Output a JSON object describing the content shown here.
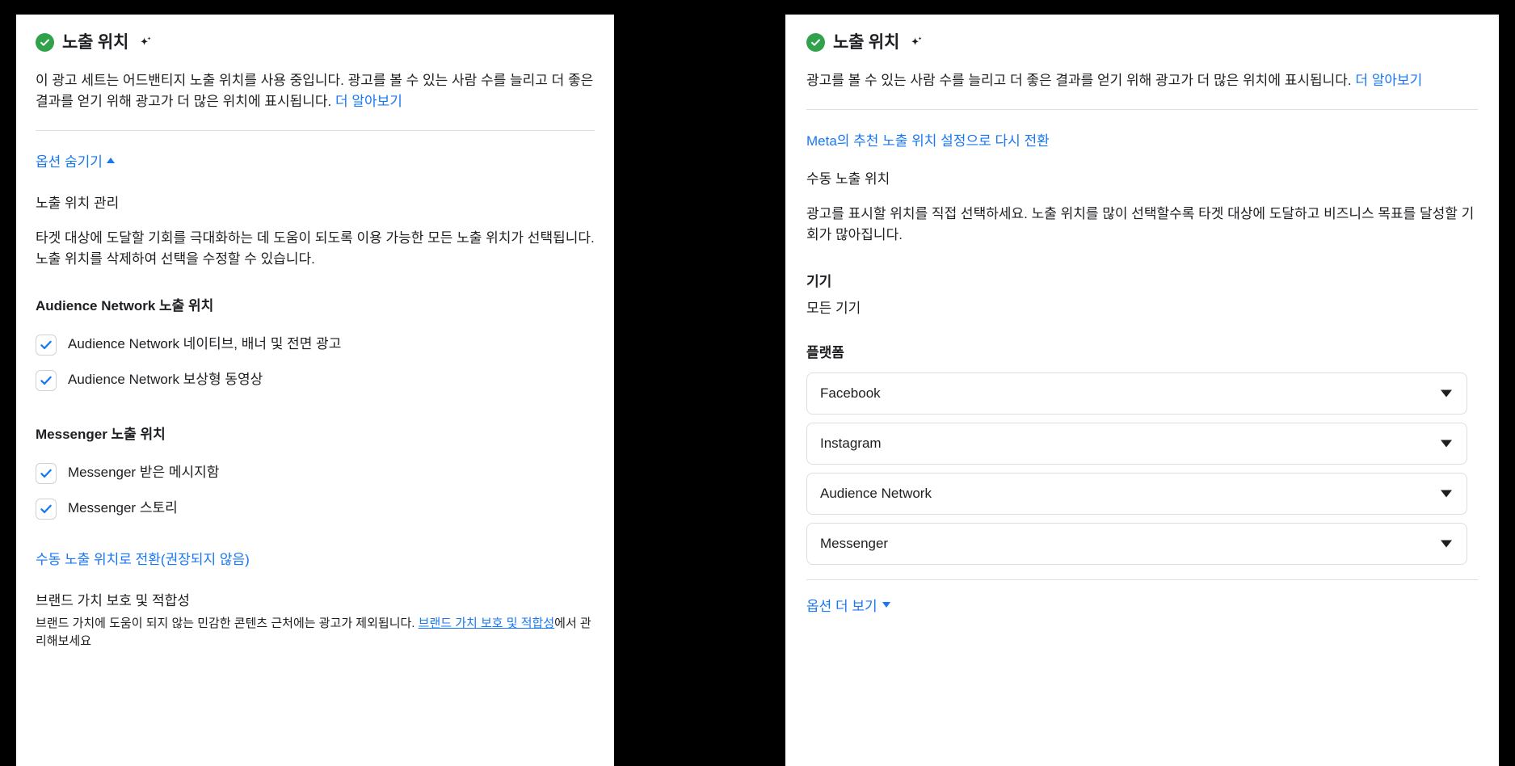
{
  "left_panel": {
    "header": {
      "status_icon": "green-check-circle-icon",
      "title": "노출 위치",
      "ai_icon": "sparkle-icon"
    },
    "intro": {
      "text": "이 광고 세트는 어드밴티지 노출 위치를 사용 중입니다. 광고를 볼 수 있는 사람 수를 늘리고 더 좋은 결과를 얻기 위해 광고가 더 많은 위치에 표시됩니다. ",
      "link": "더 알아보기"
    },
    "toggle_options": {
      "label": "옵션 숨기기",
      "caret": "caret-up-icon"
    },
    "manage_heading": "노출 위치 관리",
    "manage_body": "타겟 대상에 도달할 기회를 극대화하는 데 도움이 되도록 이용 가능한 모든 노출 위치가 선택됩니다. 노출 위치를 삭제하여 선택을 수정할 수 있습니다.",
    "groups": [
      {
        "heading": "Audience Network 노출 위치",
        "items": [
          {
            "label": "Audience Network 네이티브, 배너 및 전면 광고",
            "checked": true
          },
          {
            "label": "Audience Network 보상형 동영상",
            "checked": true
          }
        ]
      },
      {
        "heading": "Messenger 노출 위치",
        "items": [
          {
            "label": "Messenger 받은 메시지함",
            "checked": true
          },
          {
            "label": "Messenger 스토리",
            "checked": true
          }
        ]
      }
    ],
    "switch_manual_link": "수동 노출 위치로 전환(권장되지 않음)",
    "brand_safety": {
      "heading": "브랜드 가치 보호 및 적합성",
      "body_before": "브랜드 가치에 도움이 되지 않는 민감한 콘텐츠 근처에는 광고가 제외됩니다. ",
      "body_link": "브랜드 가치 보호 및 적합성",
      "body_after": "에서 관리해보세요"
    }
  },
  "right_panel": {
    "header": {
      "status_icon": "green-check-circle-icon",
      "title": "노출 위치",
      "ai_icon": "sparkle-icon"
    },
    "intro": {
      "text": "광고를 볼 수 있는 사람 수를 늘리고 더 좋은 결과를 얻기 위해 광고가 더 많은 위치에 표시됩니다. ",
      "link": "더 알아보기"
    },
    "revert_link": "Meta의 추천 노출 위치 설정으로 다시 전환",
    "manual_heading": "수동 노출 위치",
    "manual_body": "광고를 표시할 위치를 직접 선택하세요. 노출 위치를 많이 선택할수록 타겟 대상에 도달하고 비즈니스 목표를 달성할 기회가 많아집니다.",
    "device": {
      "label": "기기",
      "value": "모든 기기"
    },
    "platform": {
      "label": "플랫폼",
      "options": [
        {
          "label": "Facebook",
          "caret": "chevron-down-icon"
        },
        {
          "label": "Instagram",
          "caret": "chevron-down-icon"
        },
        {
          "label": "Audience Network",
          "caret": "chevron-down-icon"
        },
        {
          "label": "Messenger",
          "caret": "chevron-down-icon"
        }
      ]
    },
    "more_options": {
      "label": "옵션 더 보기",
      "caret": "caret-down-icon"
    }
  },
  "colors": {
    "accent_link": "#1877f2",
    "status_green": "#31a24c",
    "text_primary": "#1c1e21",
    "border": "#dcdee1",
    "page_background": "#000000"
  }
}
